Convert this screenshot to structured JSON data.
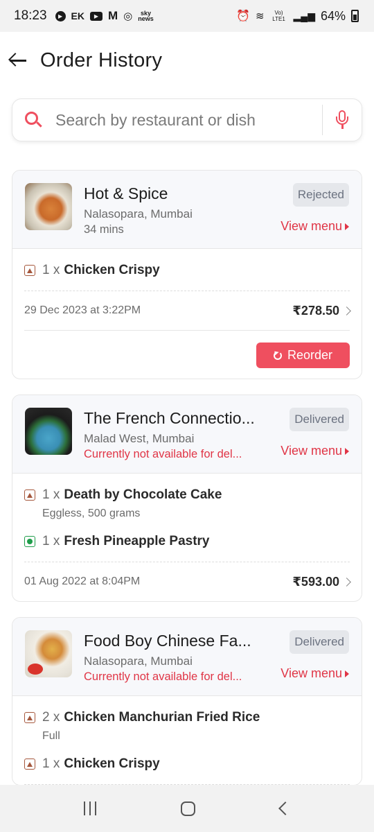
{
  "status_bar": {
    "time": "18:23",
    "ek": "EK",
    "sky": "sky",
    "sky_sub": "news",
    "network": "Vo) LTE1",
    "battery": "64%"
  },
  "header": {
    "title": "Order History"
  },
  "search": {
    "placeholder": "Search by restaurant or dish"
  },
  "colors": {
    "accent": "#ef4f5f",
    "unavailable": "#e03546",
    "nonveg": "#a5573c",
    "veg": "#1f9d4a"
  },
  "orders": [
    {
      "restaurant": "Hot & Spice",
      "location": "Nalasopara, Mumbai",
      "subtext": "34 mins",
      "status": "Rejected",
      "view_menu": "View menu",
      "items": [
        {
          "qty": "1 x",
          "name": "Chicken Crispy",
          "type": "nonveg"
        }
      ],
      "date": "29 Dec 2023 at 3:22PM",
      "total": "₹278.50",
      "reorder_label": "Reorder"
    },
    {
      "restaurant": "The French Connectio...",
      "location": "Malad West, Mumbai",
      "subtext": "Currently not available for del...",
      "status": "Delivered",
      "view_menu": "View menu",
      "items": [
        {
          "qty": "1 x",
          "name": "Death by Chocolate Cake",
          "variant": "Eggless, 500 grams",
          "type": "nonveg"
        },
        {
          "qty": "1 x",
          "name": "Fresh Pineapple Pastry",
          "type": "veg"
        }
      ],
      "date": "01 Aug 2022 at 8:04PM",
      "total": "₹593.00"
    },
    {
      "restaurant": "Food Boy Chinese Fa...",
      "location": "Nalasopara, Mumbai",
      "subtext": "Currently not available for del...",
      "status": "Delivered",
      "view_menu": "View menu",
      "items": [
        {
          "qty": "2 x",
          "name": "Chicken Manchurian Fried Rice",
          "variant": "Full",
          "type": "nonveg"
        },
        {
          "qty": "1 x",
          "name": "Chicken Crispy",
          "type": "nonveg"
        }
      ]
    }
  ]
}
